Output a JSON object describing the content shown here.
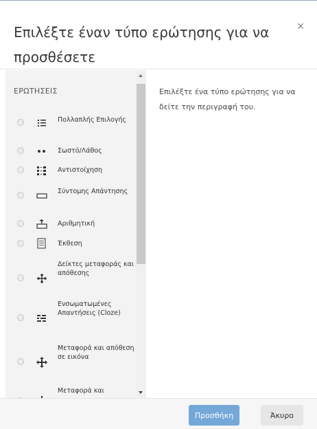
{
  "dialog": {
    "title": "Επιλέξτε έναν τύπο ερώτησης για να προσθέσετε",
    "close_icon": "close-icon"
  },
  "left_panel": {
    "section_title": "ΕΡΩΤΗΣΕΙΣ",
    "items": [
      {
        "label": "Πολλαπλής Επιλογής",
        "icon": "multiple-choice-icon"
      },
      {
        "label": "Σωστό/Λάθος",
        "icon": "true-false-icon"
      },
      {
        "label": "Αντιστοίχηση",
        "icon": "matching-icon"
      },
      {
        "label": "Σύντομης Απάντησης",
        "icon": "short-answer-icon"
      },
      {
        "label": "Αριθμητική",
        "icon": "numerical-icon"
      },
      {
        "label": "Έκθεση",
        "icon": "essay-icon"
      },
      {
        "label": "Δείκτες μεταφοράς και απόθεσης",
        "icon": "drag-drop-markers-icon"
      },
      {
        "label": "Ενσωματωμένες Απαντήσεις (Cloze)",
        "icon": "cloze-icon"
      },
      {
        "label": "Μεταφορά και απόθεση σε εικόνα",
        "icon": "drag-drop-image-icon"
      },
      {
        "label": "Μεταφορά και",
        "icon": "drag-drop-text-icon"
      }
    ]
  },
  "right_panel": {
    "description": "Επιλέξτε ένα τύπο ερώτησης για να δείτε την περιγραφή του."
  },
  "footer": {
    "add_label": "Προσθήκη",
    "cancel_label": "Άκυρο"
  },
  "colors": {
    "primary": "#74a8d9",
    "panel": "#f3f3f3"
  }
}
